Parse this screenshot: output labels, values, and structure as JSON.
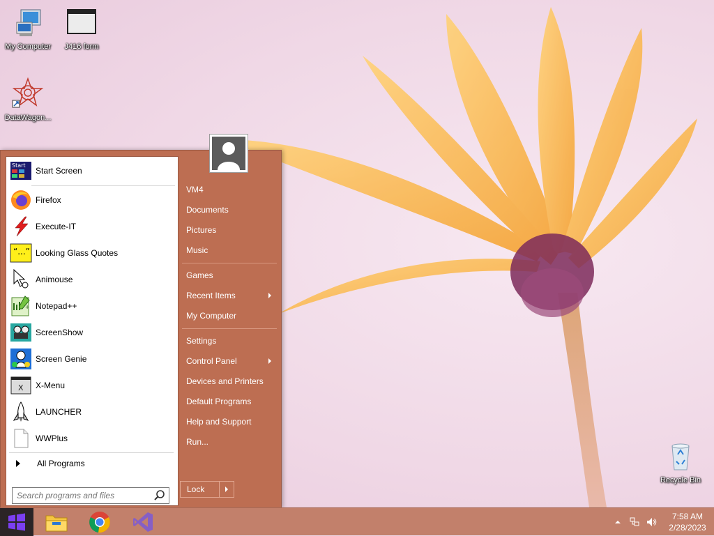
{
  "desktop": {
    "icons": [
      {
        "label": "My Computer"
      },
      {
        "label": "J416 form"
      },
      {
        "label": "DataWagon..."
      },
      {
        "label": "Recycle Bin"
      }
    ]
  },
  "start_menu": {
    "programs": [
      {
        "label": "Start Screen",
        "icon": "start-screen-icon"
      },
      {
        "label": "Firefox",
        "icon": "firefox-icon"
      },
      {
        "label": "Execute-IT",
        "icon": "lightning-icon"
      },
      {
        "label": "Looking Glass Quotes",
        "icon": "quotes-icon"
      },
      {
        "label": "Animouse",
        "icon": "mouse-cursor-icon"
      },
      {
        "label": "Notepad++",
        "icon": "notepad-plus-plus-icon"
      },
      {
        "label": "ScreenShow",
        "icon": "projector-icon"
      },
      {
        "label": "Screen Genie",
        "icon": "genie-icon"
      },
      {
        "label": "X-Menu",
        "icon": "x-menu-icon"
      },
      {
        "label": "LAUNCHER",
        "icon": "rocket-icon"
      },
      {
        "label": "WWPlus",
        "icon": "blank-file-icon"
      }
    ],
    "all_programs_label": "All Programs",
    "search_placeholder": "Search programs and files",
    "right_items": [
      {
        "label": "VM4",
        "submenu": false
      },
      {
        "label": "Documents",
        "submenu": false
      },
      {
        "label": "Pictures",
        "submenu": false
      },
      {
        "label": "Music",
        "submenu": false
      },
      {
        "label": "Games",
        "submenu": false
      },
      {
        "label": "Recent Items",
        "submenu": true
      },
      {
        "label": "My Computer",
        "submenu": false
      },
      {
        "label": "Settings",
        "submenu": false
      },
      {
        "label": "Control Panel",
        "submenu": true
      },
      {
        "label": "Devices and Printers",
        "submenu": false
      },
      {
        "label": "Default Programs",
        "submenu": false
      },
      {
        "label": "Help and Support",
        "submenu": false
      },
      {
        "label": "Run...",
        "submenu": false
      }
    ],
    "lock_label": "Lock"
  },
  "taskbar": {
    "pinned": [
      "file-explorer-icon",
      "chrome-icon",
      "visual-studio-icon"
    ],
    "clock": {
      "time": "7:58 AM",
      "date": "2/28/2023"
    }
  },
  "colors": {
    "menu_accent": "#bd6e52",
    "taskbar": "#c2806b",
    "start_button": "#2b2426"
  }
}
